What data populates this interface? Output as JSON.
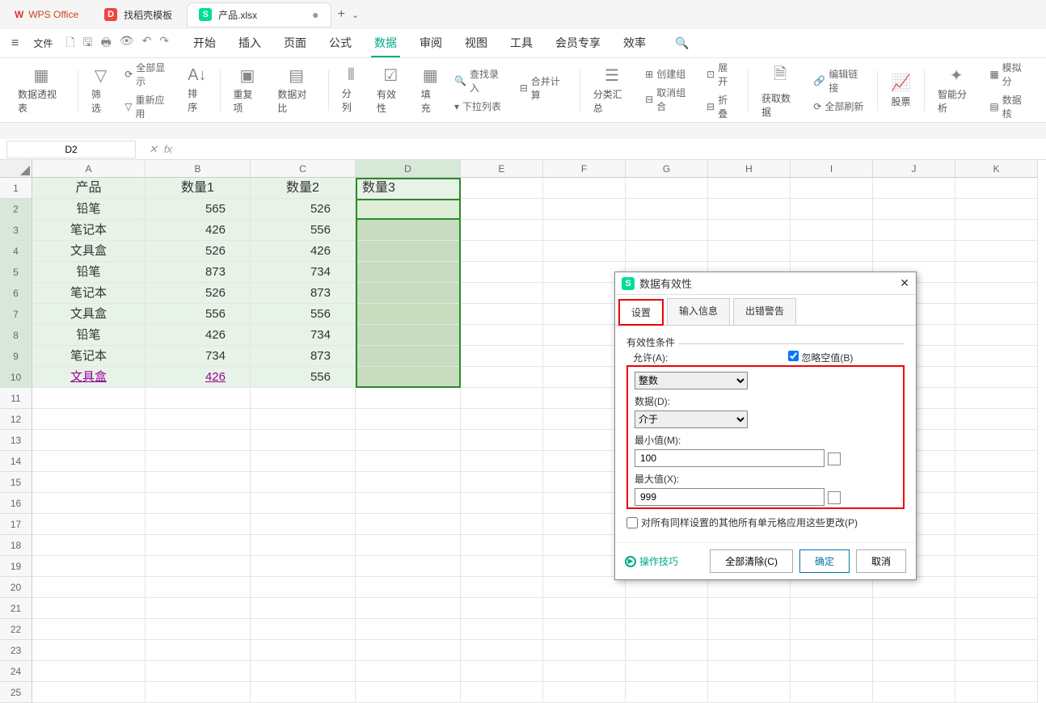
{
  "title_bar": {
    "app_name": "WPS Office",
    "template_tab": "找稻壳模板",
    "doc_name": "产品.xlsx",
    "dirty": "●",
    "add": "+"
  },
  "menu": {
    "file": "文件",
    "tabs": [
      "开始",
      "插入",
      "页面",
      "公式",
      "数据",
      "审阅",
      "视图",
      "工具",
      "会员专享",
      "效率"
    ],
    "active": 4
  },
  "ribbon": {
    "pivot": "数据透视表",
    "filter": "筛选",
    "showall": "全部显示",
    "reapply": "重新应用",
    "sort": "排序",
    "dup": "重复项",
    "valid": "数据对比",
    "split": "分列",
    "validity_d": "有效性",
    "fill": "填充",
    "lookup": "查找录入",
    "merge": "合并计算",
    "dropdown": "下拉列表",
    "subtotal": "分类汇总",
    "group": "创建组",
    "ungroup": "取消组合",
    "expand": "展开",
    "collapse": "折叠",
    "getdata": "获取数据",
    "editlink": "编辑链接",
    "refreshall": "全部刷新",
    "stock": "股票",
    "ai": "智能分析",
    "datamap": "数据核"
  },
  "fbar": {
    "name": "D2",
    "fx": "fx"
  },
  "cols": [
    "A",
    "B",
    "C",
    "D",
    "E",
    "F",
    "G",
    "H",
    "I",
    "J",
    "K"
  ],
  "table": {
    "head": [
      "产品",
      "数量1",
      "数量2",
      "数量3"
    ],
    "rows": [
      [
        "铅笔",
        "565",
        "526"
      ],
      [
        "笔记本",
        "426",
        "556"
      ],
      [
        "文具盒",
        "526",
        "426"
      ],
      [
        "铅笔",
        "873",
        "734"
      ],
      [
        "笔记本",
        "526",
        "873"
      ],
      [
        "文具盒",
        "556",
        "556"
      ],
      [
        "铅笔",
        "426",
        "734"
      ],
      [
        "笔记本",
        "734",
        "873"
      ],
      [
        "文具盒",
        "426",
        "556"
      ]
    ]
  },
  "dialog": {
    "title": "数据有效性",
    "tabs": [
      "设置",
      "输入信息",
      "出错警告"
    ],
    "section": "有效性条件",
    "allow_lbl": "允许(A):",
    "allow_val": "整数",
    "ignore": "忽略空值(B)",
    "data_lbl": "数据(D):",
    "data_val": "介于",
    "min_lbl": "最小值(M):",
    "min_val": "100",
    "max_lbl": "最大值(X):",
    "max_val": "999",
    "apply_all": "对所有同样设置的其他所有单元格应用这些更改(P)",
    "tips": "操作技巧",
    "clear": "全部清除(C)",
    "ok": "确定",
    "cancel": "取消"
  },
  "模拟分": "模拟分"
}
